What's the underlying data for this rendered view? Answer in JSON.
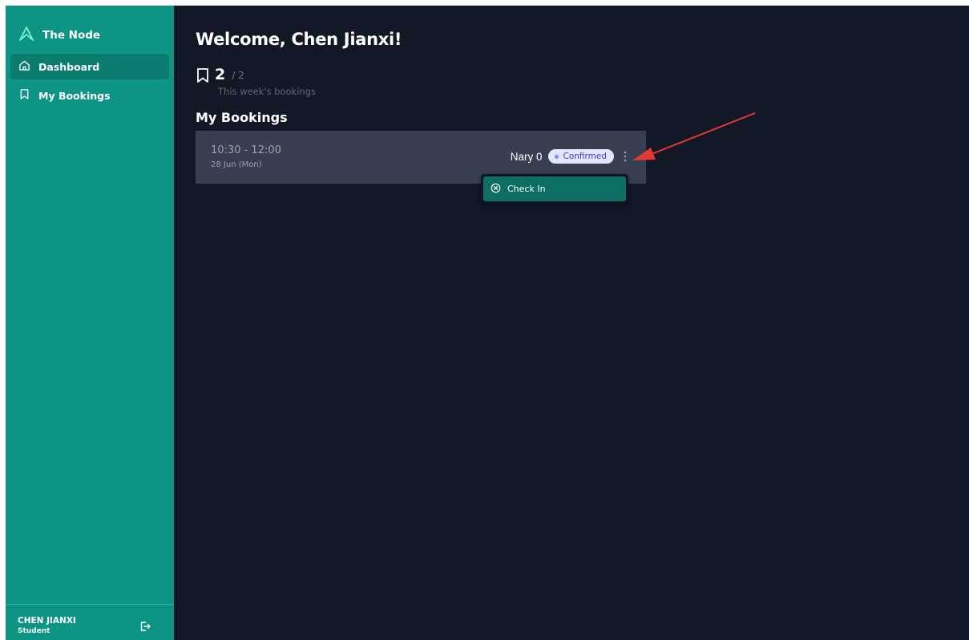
{
  "brand": {
    "name": "The Node",
    "color": "#0d9484"
  },
  "sidebar": {
    "items": [
      {
        "label": "Dashboard",
        "icon": "home-icon",
        "active": true
      },
      {
        "label": "My Bookings",
        "icon": "bookmark-icon",
        "active": false
      }
    ],
    "user": {
      "name": "CHEN JIANXI",
      "role": "Student"
    }
  },
  "main": {
    "welcome": "Welcome, Chen Jianxi!",
    "stats": {
      "count": "2",
      "total": "/ 2",
      "label": "This week's bookings"
    },
    "section_title": "My Bookings",
    "bookings": [
      {
        "time": "10:30 - 12:00",
        "date": "28 Jun (Mon)",
        "room": "Nary 0",
        "status": "Confirmed"
      }
    ],
    "dropdown": {
      "items": [
        {
          "label": "Check In",
          "icon": "x-circle-icon"
        }
      ]
    }
  },
  "colors": {
    "main_bg": "#131826",
    "card_bg": "#373f50",
    "badge_bg": "#e0e7ff",
    "badge_text": "#4338ca",
    "menu_item_bg": "#0d6f63",
    "annotation_arrow": "#e53935"
  }
}
